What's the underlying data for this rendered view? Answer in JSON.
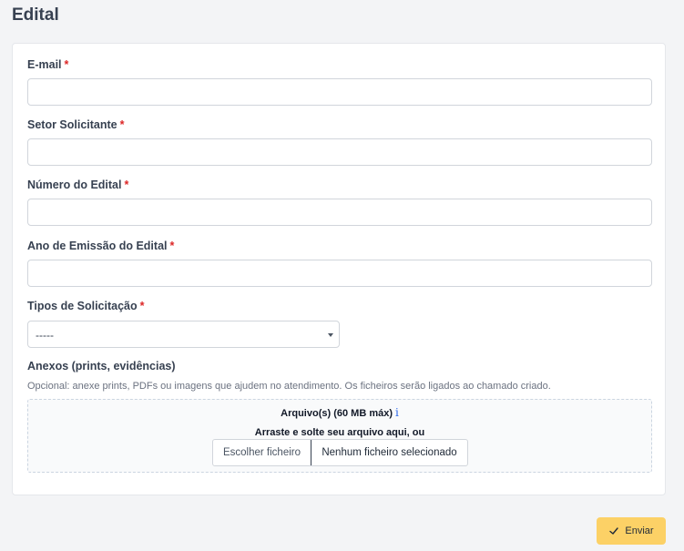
{
  "page": {
    "title": "Edital"
  },
  "form": {
    "email": {
      "label": "E-mail",
      "required": "*",
      "value": ""
    },
    "setor": {
      "label": "Setor Solicitante",
      "required": "*",
      "value": ""
    },
    "numero": {
      "label": "Número do Edital",
      "required": "*",
      "value": ""
    },
    "ano": {
      "label": "Ano de Emissão do Edital",
      "required": "*",
      "value": ""
    },
    "tipos": {
      "label": "Tipos de Solicitação",
      "required": "*",
      "selected": "-----"
    },
    "anexos": {
      "label": "Anexos (prints, evidências)",
      "hint": "Opcional: anexe prints, PDFs ou imagens que ajudem no atendimento. Os ficheiros serão ligados ao chamado criado.",
      "title": "Arquivo(s) (60 MB máx)",
      "info_icon": "i",
      "drop_text": "Arraste e solte seu arquivo aqui, ou",
      "choose_label": "Escolher ficheiro",
      "no_file_label": "Nenhum ficheiro selecionado"
    }
  },
  "actions": {
    "submit_label": "Enviar"
  },
  "colors": {
    "accent": "#fcd166",
    "required": "#dc2626",
    "info": "#2563eb"
  },
  "icons": {
    "submit": "check-icon",
    "select": "chevron-down-icon",
    "info": "info-icon"
  }
}
